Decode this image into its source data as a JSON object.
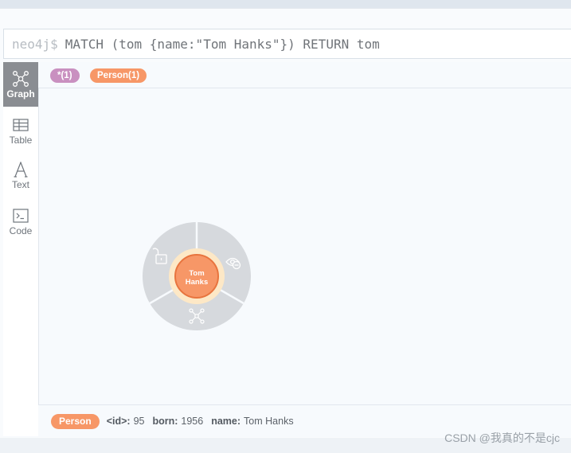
{
  "query": {
    "prompt": "neo4j$",
    "text": "MATCH (tom {name:\"Tom Hanks\"}) RETURN tom"
  },
  "sidebar": {
    "tabs": [
      {
        "label": "Graph",
        "icon": "graph-icon",
        "active": true
      },
      {
        "label": "Table",
        "icon": "table-icon",
        "active": false
      },
      {
        "label": "Text",
        "icon": "text-icon",
        "active": false
      },
      {
        "label": "Code",
        "icon": "code-icon",
        "active": false
      }
    ]
  },
  "labels": {
    "all": "*(1)",
    "person": "Person(1)"
  },
  "node": {
    "caption_line1": "Tom",
    "caption_line2": "Hanks",
    "color": "#f79767",
    "ring_actions": [
      "unlock-icon",
      "hide-icon",
      "expand-icon"
    ]
  },
  "properties": {
    "label": "Person",
    "id_key": "<id>:",
    "id_value": "95",
    "born_key": "born:",
    "born_value": "1956",
    "name_key": "name:",
    "name_value": "Tom Hanks"
  },
  "watermark": "CSDN @我真的不是cjc"
}
